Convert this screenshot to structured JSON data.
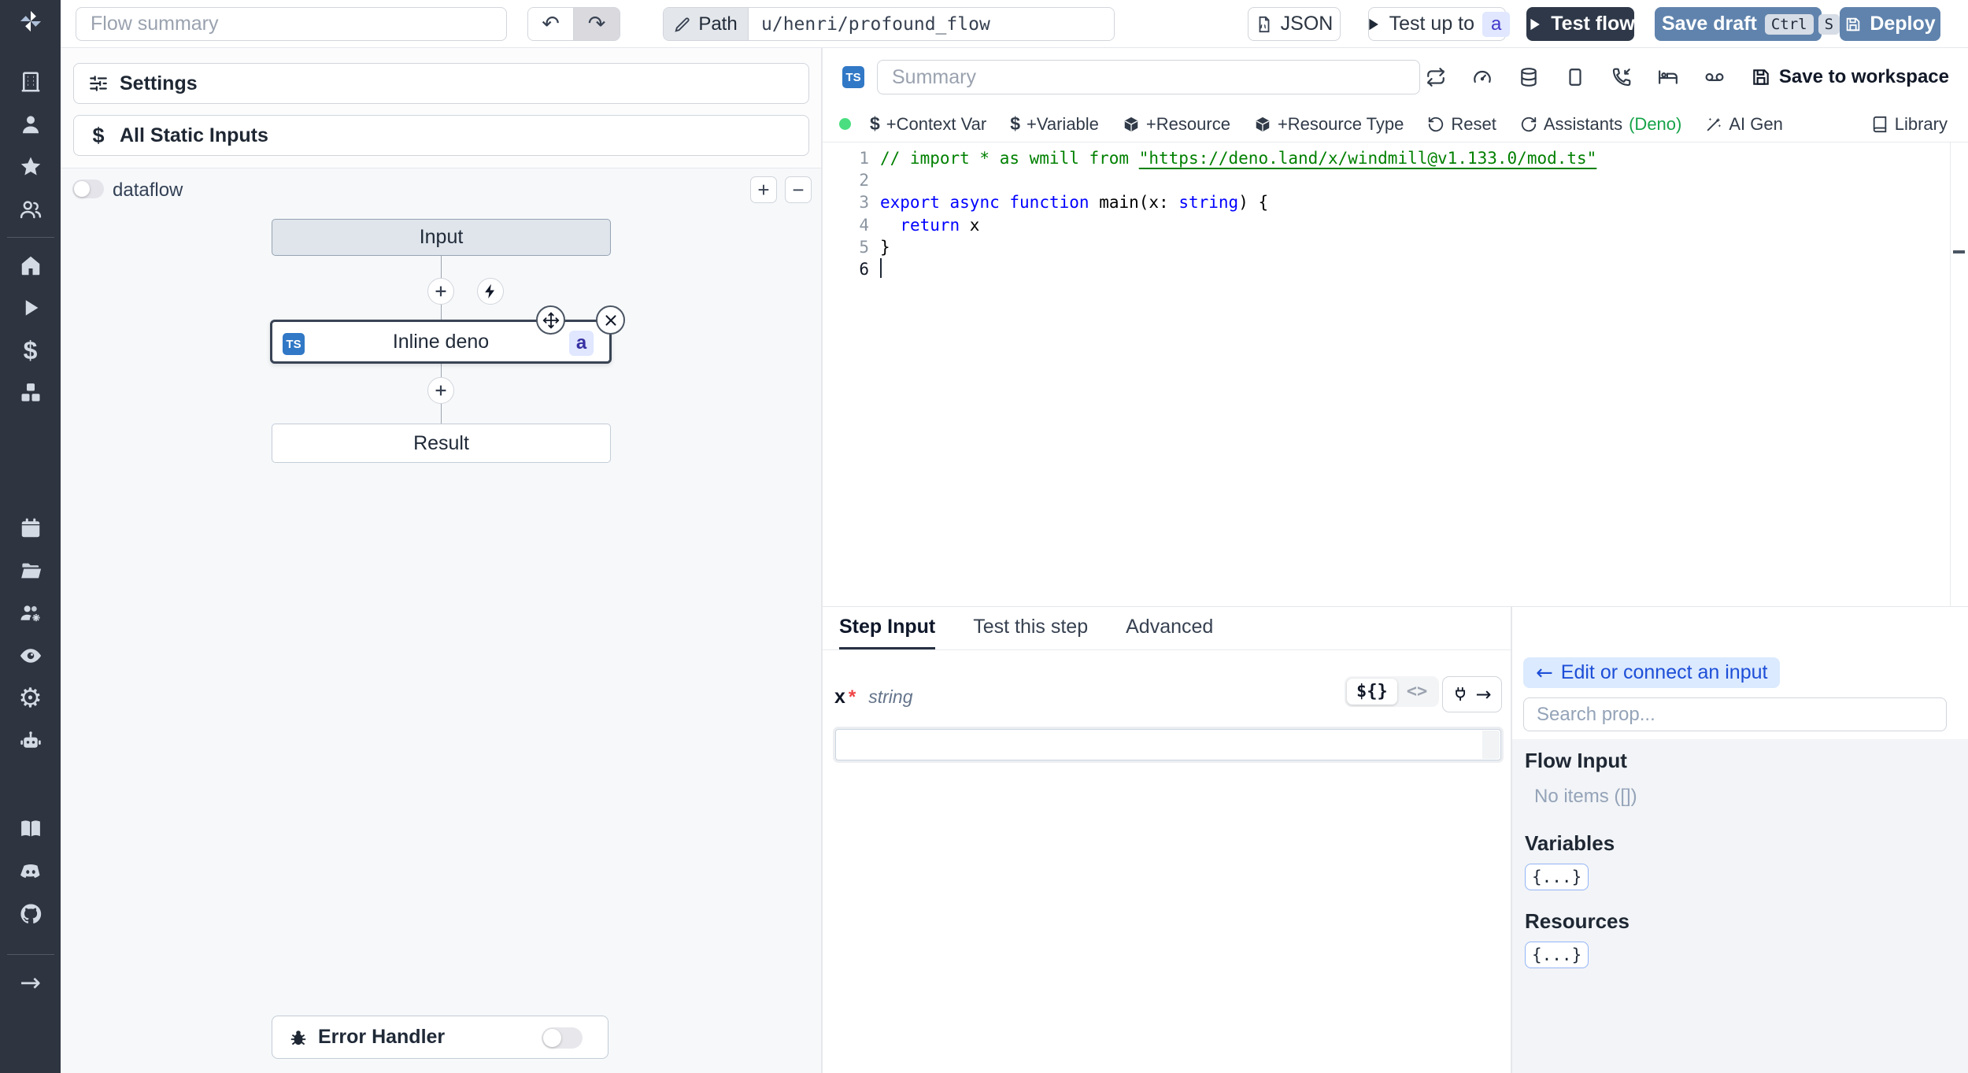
{
  "topbar": {
    "flow_summary_placeholder": "Flow summary",
    "path": {
      "label": "Path",
      "value": "u/henri/profound_flow"
    },
    "buttons": {
      "json": "JSON",
      "test_up_to": "Test up to",
      "test_up_to_badge": "a",
      "test_flow": "Test flow",
      "save_draft": "Save draft",
      "save_draft_keys": [
        "Ctrl",
        "S"
      ],
      "deploy": "Deploy"
    }
  },
  "sidebar": {
    "icons": [
      "building",
      "user",
      "star",
      "users",
      "home",
      "play",
      "dollar",
      "boxes",
      "calendar",
      "folder-open",
      "users-gear",
      "eye",
      "gear",
      "bot",
      "book-open",
      "discord",
      "github",
      "arrow-right"
    ]
  },
  "flow_panel": {
    "settings_label": "Settings",
    "static_inputs_label": "All Static Inputs",
    "dataflow_label": "dataflow",
    "zoom_in": "+",
    "zoom_out": "−",
    "nodes": {
      "input": "Input",
      "step_label": "Inline deno",
      "step_lang": "TS",
      "step_badge": "a",
      "result": "Result"
    },
    "error_handler_label": "Error Handler"
  },
  "editor": {
    "lang_badge": "TS",
    "summary_placeholder": "Summary",
    "save_to_workspace_label": "Save to workspace",
    "status_color": "#4ade80",
    "actions": [
      {
        "label": "+Context Var"
      },
      {
        "label": "+Variable"
      },
      {
        "label": "+Resource"
      },
      {
        "label": "+Resource Type"
      },
      {
        "label": "Reset"
      },
      {
        "label": "Assistants",
        "suffix": "(Deno)"
      },
      {
        "label": "AI Gen"
      }
    ],
    "library_label": "Library",
    "code": {
      "lines": [
        {
          "num": "1",
          "tokens": [
            {
              "c": "comment",
              "t": "// import * as wmill from "
            },
            {
              "c": "link",
              "t": "\"https://deno.land/x/windmill@v1.133.0/mod.ts\""
            }
          ]
        },
        {
          "num": "2",
          "tokens": []
        },
        {
          "num": "3",
          "tokens": [
            {
              "c": "keyword",
              "t": "export"
            },
            {
              "c": "plain",
              "t": " "
            },
            {
              "c": "keyword",
              "t": "async"
            },
            {
              "c": "plain",
              "t": " "
            },
            {
              "c": "keyword",
              "t": "function"
            },
            {
              "c": "plain",
              "t": " main(x: "
            },
            {
              "c": "keyword",
              "t": "string"
            },
            {
              "c": "plain",
              "t": ") {"
            }
          ]
        },
        {
          "num": "4",
          "tokens": [
            {
              "c": "plain",
              "t": "  "
            },
            {
              "c": "keyword",
              "t": "return"
            },
            {
              "c": "plain",
              "t": " x"
            }
          ]
        },
        {
          "num": "5",
          "tokens": [
            {
              "c": "plain",
              "t": "}"
            }
          ]
        },
        {
          "num": "6",
          "tokens": [],
          "cursor": true
        }
      ]
    }
  },
  "step_panel": {
    "tabs": [
      {
        "label": "Step Input"
      },
      {
        "label": "Test this step"
      },
      {
        "label": "Advanced"
      }
    ],
    "field": {
      "name": "x",
      "required_marker": "*",
      "type": "string",
      "value": ""
    },
    "mode_toggle": {
      "template": "${}",
      "code": "<>"
    }
  },
  "prop_picker": {
    "back_label": "Edit or connect an input",
    "search_placeholder": "Search prop...",
    "flow_input_title": "Flow Input",
    "flow_input_empty": "No items ([])",
    "variables_title": "Variables",
    "variables_chip": "{...}",
    "resources_title": "Resources",
    "resources_chip": "{...}"
  },
  "colors": {
    "sidebar_bg": "#2e3440",
    "primary_steel": "#6083ad",
    "dark_button": "#2e3848",
    "ts_badge": "#3178c6",
    "status_green": "#4ade80",
    "deno_green": "#16a34a",
    "badge_indigo_bg": "#e0e7ff",
    "badge_indigo_text": "#4338ca",
    "back_btn_bg": "#dbeafe",
    "back_btn_text": "#1d4ed8",
    "code_keyword": "#0000ff",
    "code_comment": "#008000"
  }
}
